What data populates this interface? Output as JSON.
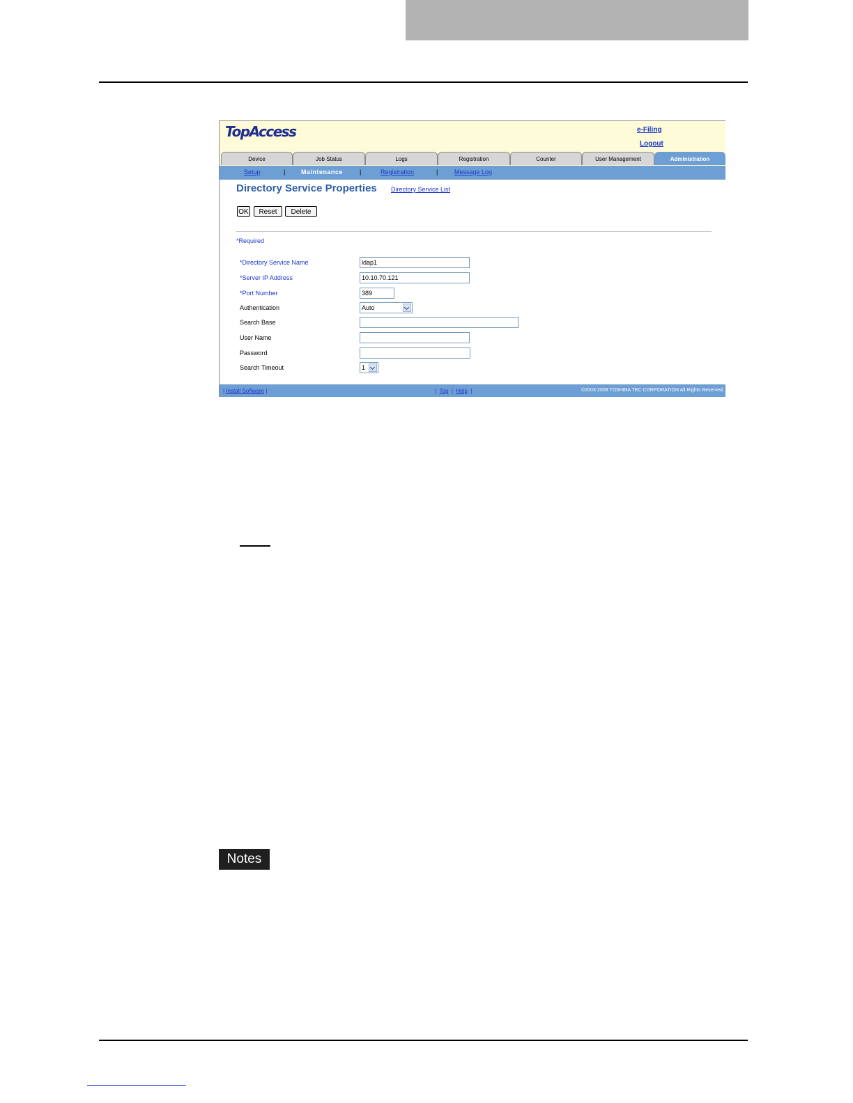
{
  "app": {
    "logo": "TopAccess",
    "links": {
      "efiling": "e-Filing",
      "logout": "Logout"
    },
    "tabs": [
      "Device",
      "Job Status",
      "Logs",
      "Registration",
      "Counter",
      "User Management",
      "Administration"
    ],
    "subnav": {
      "setup": "Setup",
      "maintenance": "Maintenance",
      "registration": "Registration",
      "message_log": "Message Log",
      "sep": "|"
    },
    "page_title": "Directory Service Properties",
    "page_link": "Directory Service List",
    "buttons": {
      "ok": "OK",
      "reset": "Reset",
      "delete": "Delete"
    },
    "required_note": "*Required",
    "fields": {
      "dir_name": {
        "label": "*Directory Service Name",
        "value": "ldap1"
      },
      "server_ip": {
        "label": "*Server IP Address",
        "value": "10.10.70.121"
      },
      "port": {
        "label": "*Port Number",
        "value": "389"
      },
      "auth": {
        "label": "Authentication",
        "value": "Auto"
      },
      "search_base": {
        "label": "Search Base",
        "value": ""
      },
      "user_name": {
        "label": "User Name",
        "value": ""
      },
      "password": {
        "label": "Password",
        "value": ""
      },
      "timeout": {
        "label": "Search Timeout",
        "value": "1"
      }
    },
    "footer": {
      "install": "Install Software",
      "top": "Top",
      "help": "Help",
      "copyright": "©2003-2008 TOSHIBA TEC CORPORATION All Rights Reserved."
    }
  },
  "document": {
    "notes_label": "Notes"
  },
  "colors": {
    "accent": "#6e9fd4",
    "header_bg": "#fefbd9",
    "link": "#1a35c8",
    "title": "#2f5fa8"
  }
}
